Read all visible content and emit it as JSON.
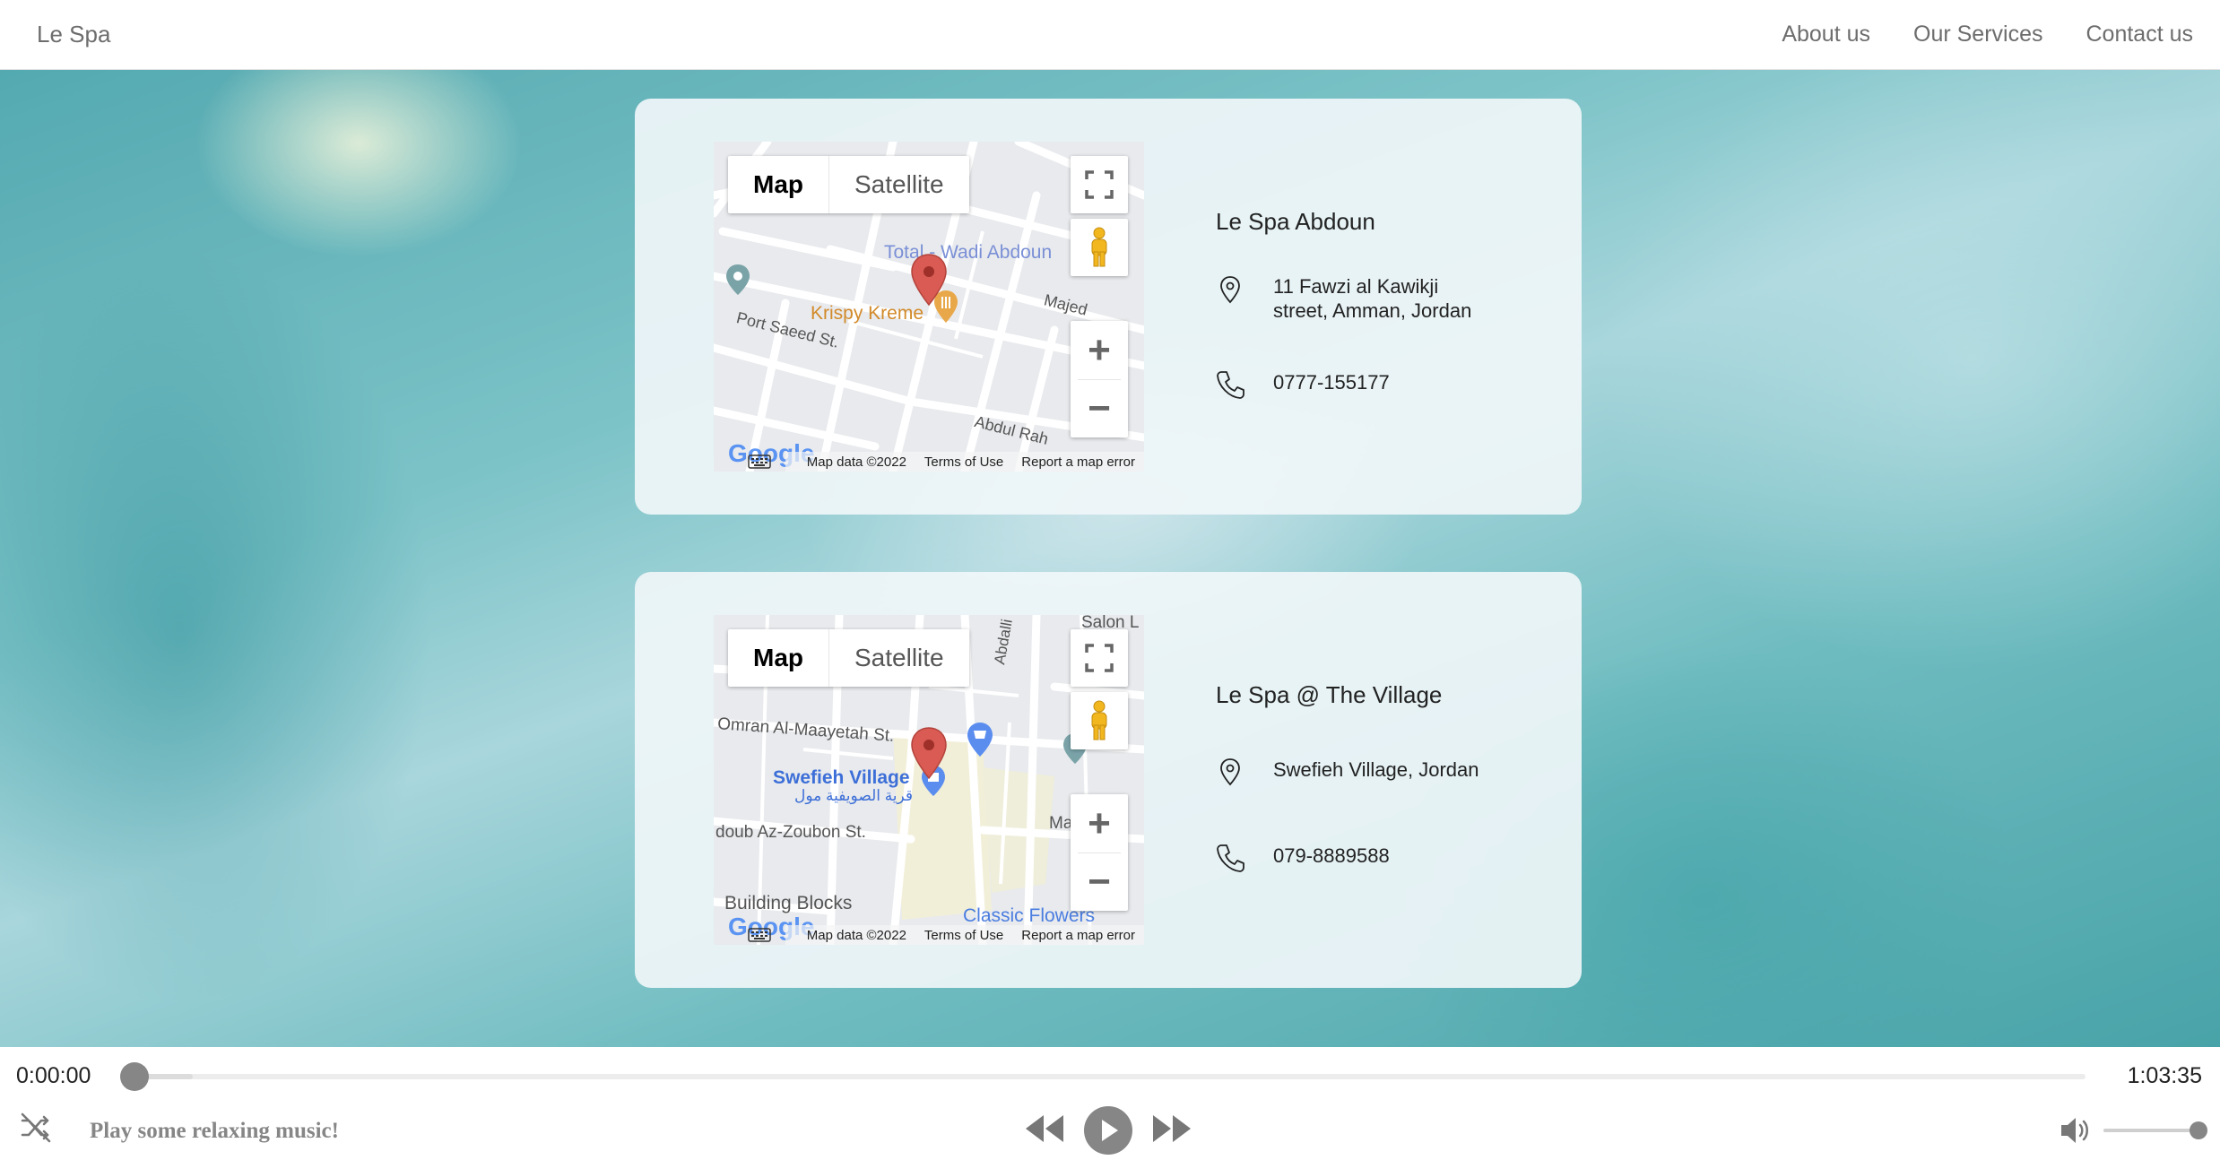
{
  "navbar": {
    "brand": "Le Spa",
    "links": [
      "About us",
      "Our Services",
      "Contact us"
    ]
  },
  "map_controls": {
    "map_label": "Map",
    "satellite_label": "Satellite",
    "zoom_in": "+",
    "zoom_out": "−",
    "map_data": "Map data ©2022",
    "terms": "Terms of Use",
    "report": "Report a map error",
    "google": "Google"
  },
  "locations": [
    {
      "name": "Le Spa Abdoun",
      "address_line1": "11 Fawzi al Kawikji",
      "address_line2": "street, Amman, Jordan",
      "phone": "0777-155177",
      "map_labels": {
        "place1": "Total - Wadi Abdoun",
        "place2": "Krispy Kreme",
        "street1": "Port Saeed St.",
        "street2": "Majed",
        "street3": "Abdul Rah"
      }
    },
    {
      "name": "Le Spa @ The Village",
      "address_line1": "Swefieh Village, Jordan",
      "phone": "079-8889588",
      "map_labels": {
        "place1": "Swefieh Village",
        "place1_ar": "قرية الصويفية مول",
        "street1": "Omran Al-Maayetah St.",
        "street2": "doub Az-Zoubon St.",
        "place2": "Building Blocks",
        "place3": "Classic Flowers",
        "place4": "Salon L",
        "street3": "Abdalli",
        "street4": "Ma"
      }
    }
  ],
  "player": {
    "current_time": "0:00:00",
    "total_time": "1:03:35",
    "track_title": "Play some relaxing music!",
    "progress": 0.03,
    "volume": 1.0
  }
}
